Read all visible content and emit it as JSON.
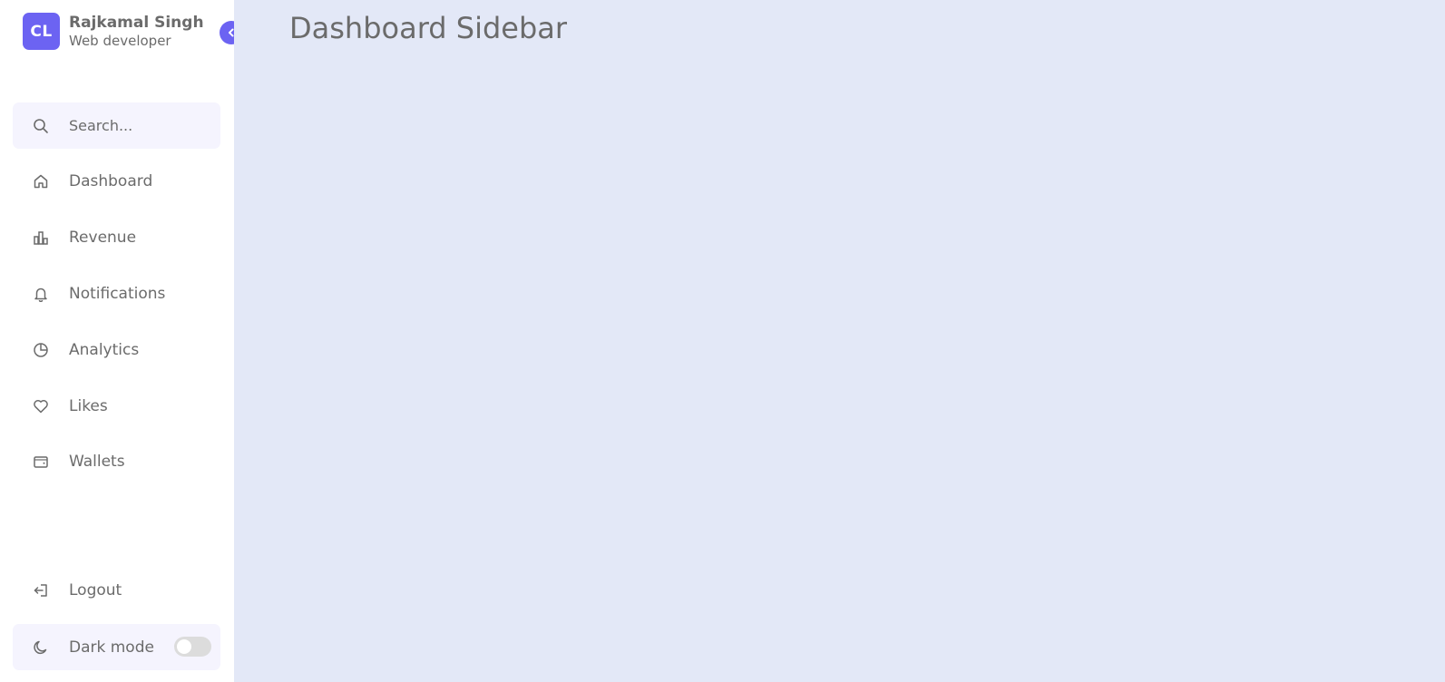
{
  "profile": {
    "logo_text": "CL",
    "name": "Rajkamal Singh",
    "role": "Web developer"
  },
  "search": {
    "placeholder": "Search..."
  },
  "nav": {
    "items": [
      {
        "label": "Dashboard",
        "icon": "home-icon"
      },
      {
        "label": "Revenue",
        "icon": "bar-chart-icon"
      },
      {
        "label": "Notifications",
        "icon": "bell-icon"
      },
      {
        "label": "Analytics",
        "icon": "pie-chart-icon"
      },
      {
        "label": "Likes",
        "icon": "heart-icon"
      },
      {
        "label": "Wallets",
        "icon": "wallet-icon"
      }
    ]
  },
  "footer": {
    "logout_label": "Logout",
    "darkmode_label": "Dark mode",
    "darkmode_on": false
  },
  "main": {
    "title": "Dashboard Sidebar"
  },
  "colors": {
    "accent": "#6c63f2",
    "sidebar_bg": "#ffffff",
    "main_bg": "#e3e8f7",
    "search_bg": "#f5f4fe",
    "text": "#6b6b6b"
  }
}
